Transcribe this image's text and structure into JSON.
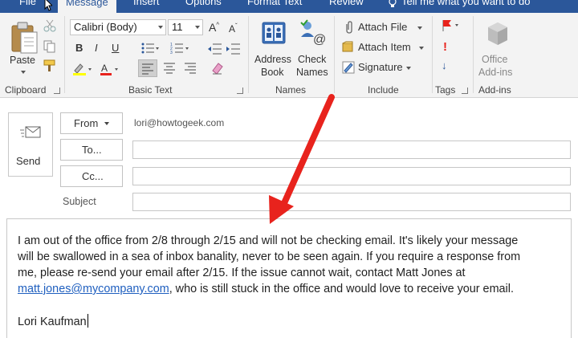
{
  "tabs": [
    {
      "label": "File"
    },
    {
      "label": "Message"
    },
    {
      "label": "Insert"
    },
    {
      "label": "Options"
    },
    {
      "label": "Format Text"
    },
    {
      "label": "Review"
    }
  ],
  "tell_me": "Tell me what you want to do",
  "ribbon": {
    "clipboard": {
      "paste": "Paste",
      "label": "Clipboard"
    },
    "basic_text": {
      "font": "Calibri (Body)",
      "size": "11",
      "label": "Basic Text"
    },
    "names": {
      "address_book_1": "Address",
      "address_book_2": "Book",
      "check_names_1": "Check",
      "check_names_2": "Names",
      "label": "Names"
    },
    "include": {
      "attach_file": "Attach File",
      "attach_item": "Attach Item",
      "signature": "Signature",
      "label": "Include"
    },
    "tags": {
      "label": "Tags"
    },
    "addins": {
      "office_1": "Office",
      "office_2": "Add-ins",
      "label": "Add-ins"
    }
  },
  "compose": {
    "send": "Send",
    "from_label": "From",
    "from_value": "lori@howtogeek.com",
    "to_label": "To...",
    "cc_label": "Cc...",
    "subject_label": "Subject",
    "body": {
      "line1": "I am out of the office from 2/8 through 2/15 and will not be checking email. It's likely your message",
      "line2": "will be swallowed in a sea of inbox banality, never to be seen again. If you require a response from",
      "line3": "me, please re-send your email after 2/15. If the issue cannot wait, contact Matt Jones at",
      "link": "matt.jones@mycompany.com",
      "line4_rest": ", who is still stuck in the office and would love to receive your email.",
      "signature": "Lori Kaufman"
    }
  },
  "colors": {
    "accent": "#2b579a",
    "annotation_arrow": "#e8231d",
    "link": "#1f5fbf"
  }
}
